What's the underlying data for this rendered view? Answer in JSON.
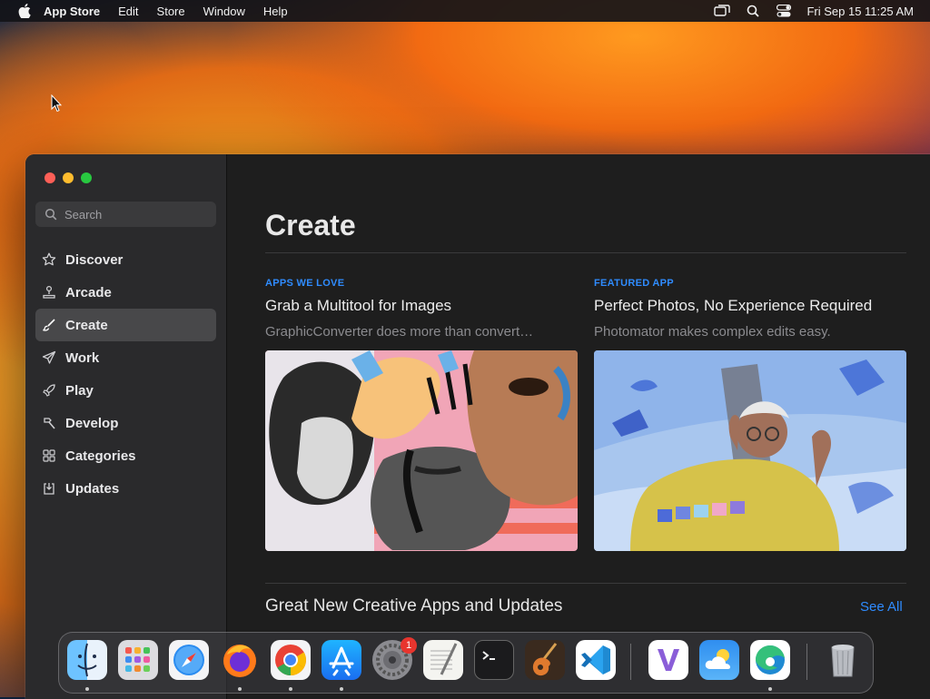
{
  "menubar": {
    "app_name": "App Store",
    "items": [
      "Edit",
      "Store",
      "Window",
      "Help"
    ],
    "clock": "Fri Sep 15  11:25 AM",
    "icons": [
      "screen-mirroring-icon",
      "spotlight-search-icon",
      "control-center-icon"
    ]
  },
  "window": {
    "search": {
      "placeholder": "Search"
    },
    "nav": [
      {
        "label": "Discover",
        "icon": "star-icon"
      },
      {
        "label": "Arcade",
        "icon": "joystick-icon"
      },
      {
        "label": "Create",
        "icon": "paintbrush-icon",
        "active": true
      },
      {
        "label": "Work",
        "icon": "paperplane-icon"
      },
      {
        "label": "Play",
        "icon": "rocket-icon"
      },
      {
        "label": "Develop",
        "icon": "hammer-icon"
      },
      {
        "label": "Categories",
        "icon": "grid-icon"
      },
      {
        "label": "Updates",
        "icon": "download-icon"
      }
    ],
    "page_title": "Create",
    "cards": [
      {
        "eyebrow": "APPS WE LOVE",
        "headline": "Grab a Multitool for Images",
        "sub": "GraphicConverter does more than convert…"
      },
      {
        "eyebrow": "FEATURED APP",
        "headline": "Perfect Photos, No Experience Required",
        "sub": "Photomator makes complex edits easy."
      }
    ],
    "section": {
      "title": "Great New Creative Apps and Updates",
      "see_all": "See All"
    }
  },
  "dock": {
    "apps": [
      "Finder",
      "Launchpad",
      "Safari",
      "Firefox",
      "Chrome",
      "App Store",
      "System Settings",
      "TextEdit",
      "Terminal",
      "GarageBand",
      "VS Code",
      "Visual Studio",
      "Weather",
      "Edge",
      "Trash"
    ],
    "settings_badge": "1"
  },
  "colors": {
    "accent": "#2f8cff",
    "sidebar_bg": "#2a2a2c",
    "main_bg": "#1e1e1e"
  }
}
